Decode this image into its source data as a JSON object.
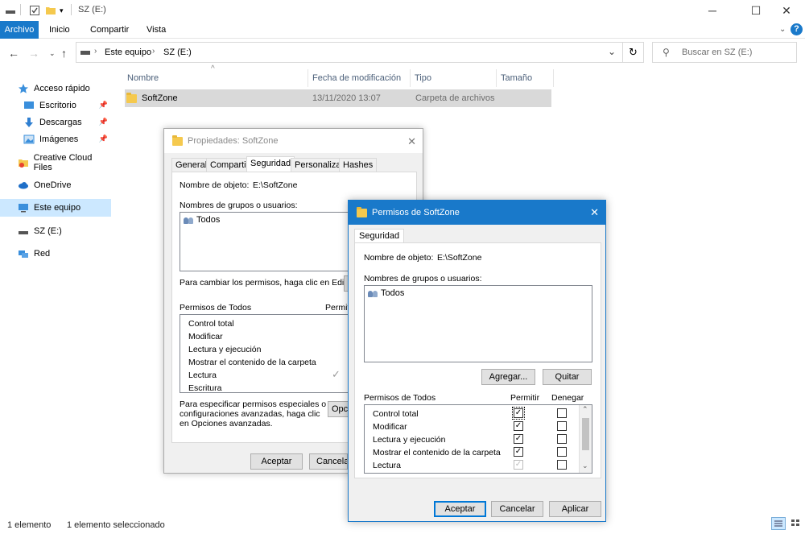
{
  "window": {
    "title": "SZ (E:)"
  },
  "ribbon": {
    "tabs": [
      "Archivo",
      "Inicio",
      "Compartir",
      "Vista"
    ]
  },
  "address": {
    "crumbs": [
      "Este equipo",
      "SZ (E:)"
    ],
    "search_placeholder": "Buscar en SZ (E:)"
  },
  "nav": {
    "items": [
      {
        "label": "Acceso rápido",
        "icon": "star-icon"
      },
      {
        "label": "Escritorio",
        "icon": "desktop-icon",
        "pinned": true
      },
      {
        "label": "Descargas",
        "icon": "download-icon",
        "pinned": true
      },
      {
        "label": "Imágenes",
        "icon": "pictures-icon",
        "pinned": true
      },
      {
        "label": "Creative Cloud Files",
        "icon": "creative-cloud-icon"
      },
      {
        "label": "OneDrive",
        "icon": "cloud-icon"
      },
      {
        "label": "Este equipo",
        "icon": "computer-icon",
        "selected": true
      },
      {
        "label": "SZ (E:)",
        "icon": "drive-icon"
      },
      {
        "label": "Red",
        "icon": "network-icon"
      }
    ]
  },
  "filelist": {
    "columns": [
      "Nombre",
      "Fecha de modificación",
      "Tipo",
      "Tamaño"
    ],
    "rows": [
      {
        "name": "SoftZone",
        "date": "13/11/2020 13:07",
        "type": "Carpeta de archivos",
        "size": ""
      }
    ]
  },
  "status": {
    "count": "1 elemento",
    "selected": "1 elemento seleccionado"
  },
  "props_dialog": {
    "title": "Propiedades: SoftZone",
    "tabs": [
      "General",
      "Compartir",
      "Seguridad",
      "Personalizar",
      "Hashes"
    ],
    "object_label": "Nombre de objeto:",
    "object_value": "E:\\SoftZone",
    "groups_label": "Nombres de grupos o usuarios:",
    "groups": [
      "Todos"
    ],
    "change_hint": "Para cambiar los permisos, haga clic en Editar.",
    "perms_label": "Permisos de Todos",
    "allow_header": "Permitir",
    "perms": [
      "Control total",
      "Modificar",
      "Lectura y ejecución",
      "Mostrar el contenido de la carpeta",
      "Lectura",
      "Escritura"
    ],
    "special_hint_1": "Para especificar permisos especiales o",
    "special_hint_2": "configuraciones avanzadas, haga clic",
    "special_hint_3": "en Opciones avanzadas.",
    "options_button": "Opciones",
    "ok": "Aceptar",
    "cancel": "Cancelar"
  },
  "perm_dialog": {
    "title": "Permisos de SoftZone",
    "tab": "Seguridad",
    "object_label": "Nombre de objeto:",
    "object_value": "E:\\SoftZone",
    "groups_label": "Nombres de grupos o usuarios:",
    "groups": [
      "Todos"
    ],
    "add": "Agregar...",
    "remove": "Quitar",
    "perms_label": "Permisos de Todos",
    "allow_header": "Permitir",
    "deny_header": "Denegar",
    "perms": [
      {
        "label": "Control total",
        "allow": true,
        "allow_disabled": false,
        "deny": false
      },
      {
        "label": "Modificar",
        "allow": true,
        "allow_disabled": false,
        "deny": false
      },
      {
        "label": "Lectura y ejecución",
        "allow": true,
        "allow_disabled": false,
        "deny": false
      },
      {
        "label": "Mostrar el contenido de la carpeta",
        "allow": true,
        "allow_disabled": false,
        "deny": false
      },
      {
        "label": "Lectura",
        "allow": true,
        "allow_disabled": true,
        "deny": false
      }
    ],
    "ok": "Aceptar",
    "cancel": "Cancelar",
    "apply": "Aplicar"
  },
  "colors": {
    "accent": "#0078d7",
    "file_tab": "#1979ca",
    "selection": "#cce8ff",
    "folder": "#f5c94e"
  }
}
